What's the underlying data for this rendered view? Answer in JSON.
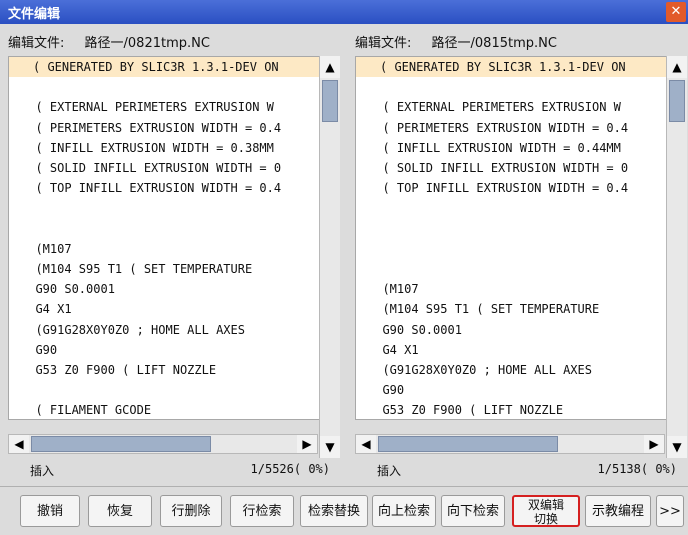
{
  "window": {
    "title": "文件编辑",
    "close": "✕"
  },
  "panes": [
    {
      "file_label": "编辑文件:",
      "file_path": "路径一/0821tmp.NC",
      "cursor": ">",
      "lines": [
        {
          "text": "( GENERATED BY SLIC3R 1.3.1-DEV ON",
          "hl": true
        },
        {
          "text": ""
        },
        {
          "text": "  ( EXTERNAL PERIMETERS EXTRUSION W"
        },
        {
          "text": "  ( PERIMETERS EXTRUSION WIDTH = 0.4"
        },
        {
          "text": "  ( INFILL EXTRUSION WIDTH = 0.38MM"
        },
        {
          "text": "  ( SOLID INFILL EXTRUSION WIDTH = 0"
        },
        {
          "text": "  ( TOP INFILL EXTRUSION WIDTH = 0.4"
        },
        {
          "text": ""
        },
        {
          "text": ""
        },
        {
          "text": "  (M107"
        },
        {
          "text": "  (M104 S95 T1 ( SET TEMPERATURE"
        },
        {
          "text": "  G90 S0.0001"
        },
        {
          "text": "  G4 X1"
        },
        {
          "text": "  (G91G28X0Y0Z0 ; HOME ALL AXES"
        },
        {
          "text": "  G90"
        },
        {
          "text": "  G53 Z0 F900 ( LIFT NOZZLE"
        },
        {
          "text": ""
        },
        {
          "text": "  ( FILAMENT GCODE"
        }
      ],
      "status_mode": "插入",
      "status_pos": "1/5526( 0%)"
    },
    {
      "file_label": "编辑文件:",
      "file_path": "路径一/0815tmp.NC",
      "cursor": ">",
      "lines": [
        {
          "text": "( GENERATED BY SLIC3R 1.3.1-DEV ON",
          "hl": true
        },
        {
          "text": ""
        },
        {
          "text": "  ( EXTERNAL PERIMETERS EXTRUSION W"
        },
        {
          "text": "  ( PERIMETERS EXTRUSION WIDTH = 0.4"
        },
        {
          "text": "  ( INFILL EXTRUSION WIDTH = 0.44MM"
        },
        {
          "text": "  ( SOLID INFILL EXTRUSION WIDTH = 0"
        },
        {
          "text": "  ( TOP INFILL EXTRUSION WIDTH = 0.4"
        },
        {
          "text": ""
        },
        {
          "text": ""
        },
        {
          "text": ""
        },
        {
          "text": ""
        },
        {
          "text": "  (M107"
        },
        {
          "text": "  (M104 S95 T1 ( SET TEMPERATURE"
        },
        {
          "text": "  G90 S0.0001"
        },
        {
          "text": "  G4 X1"
        },
        {
          "text": "  (G91G28X0Y0Z0 ; HOME ALL AXES"
        },
        {
          "text": "  G90"
        },
        {
          "text": "  G53 Z0 F900 ( LIFT NOZZLE"
        }
      ],
      "status_mode": "插入",
      "status_pos": "1/5138( 0%)"
    }
  ],
  "scroll": {
    "up": "▲",
    "down": "▼",
    "left": "◀",
    "right": "▶"
  },
  "toolbar": {
    "undo": "撤销",
    "redo": "恢复",
    "delete_line": "行删除",
    "line_search": "行检索",
    "search_replace": "检索替换",
    "search_up": "向上检索",
    "search_down": "向下检索",
    "dual_edit_line1": "双编辑",
    "dual_edit_line2": "切换",
    "teach_program": "示教编程",
    "more": ">>"
  }
}
